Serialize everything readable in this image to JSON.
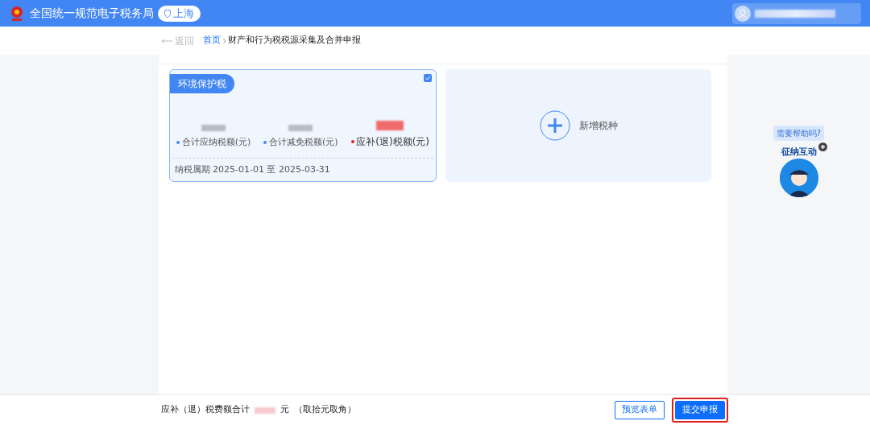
{
  "header": {
    "title": "全国统一规范电子税务局",
    "region": "上海"
  },
  "breadcrumb": {
    "back": "返回",
    "items": [
      {
        "label": "首页",
        "link": true
      },
      {
        "label": "财产和行为税税源采集及合并申报",
        "link": false
      }
    ]
  },
  "tax_cards": [
    {
      "title": "环境保护税",
      "selected": true,
      "metrics": [
        {
          "label": "合计应纳税额(元)",
          "emphasis": false
        },
        {
          "label": "合计减免税额(元)",
          "emphasis": false
        },
        {
          "label": "应补(退)税额(元)",
          "emphasis": true
        }
      ],
      "period": "纳税属期 2025-01-01 至 2025-03-31"
    }
  ],
  "add_card": {
    "label": "新增税种"
  },
  "assistant": {
    "bubble": "需要帮助吗?",
    "badge": "征纳互动"
  },
  "footer": {
    "total_label": "应补（退）税费额合计",
    "unit": "元",
    "note": "（取拾元取角）",
    "buttons": [
      {
        "label": "预览表单",
        "kind": "outline"
      },
      {
        "label": "提交申报",
        "kind": "primary",
        "highlighted": true
      }
    ]
  }
}
